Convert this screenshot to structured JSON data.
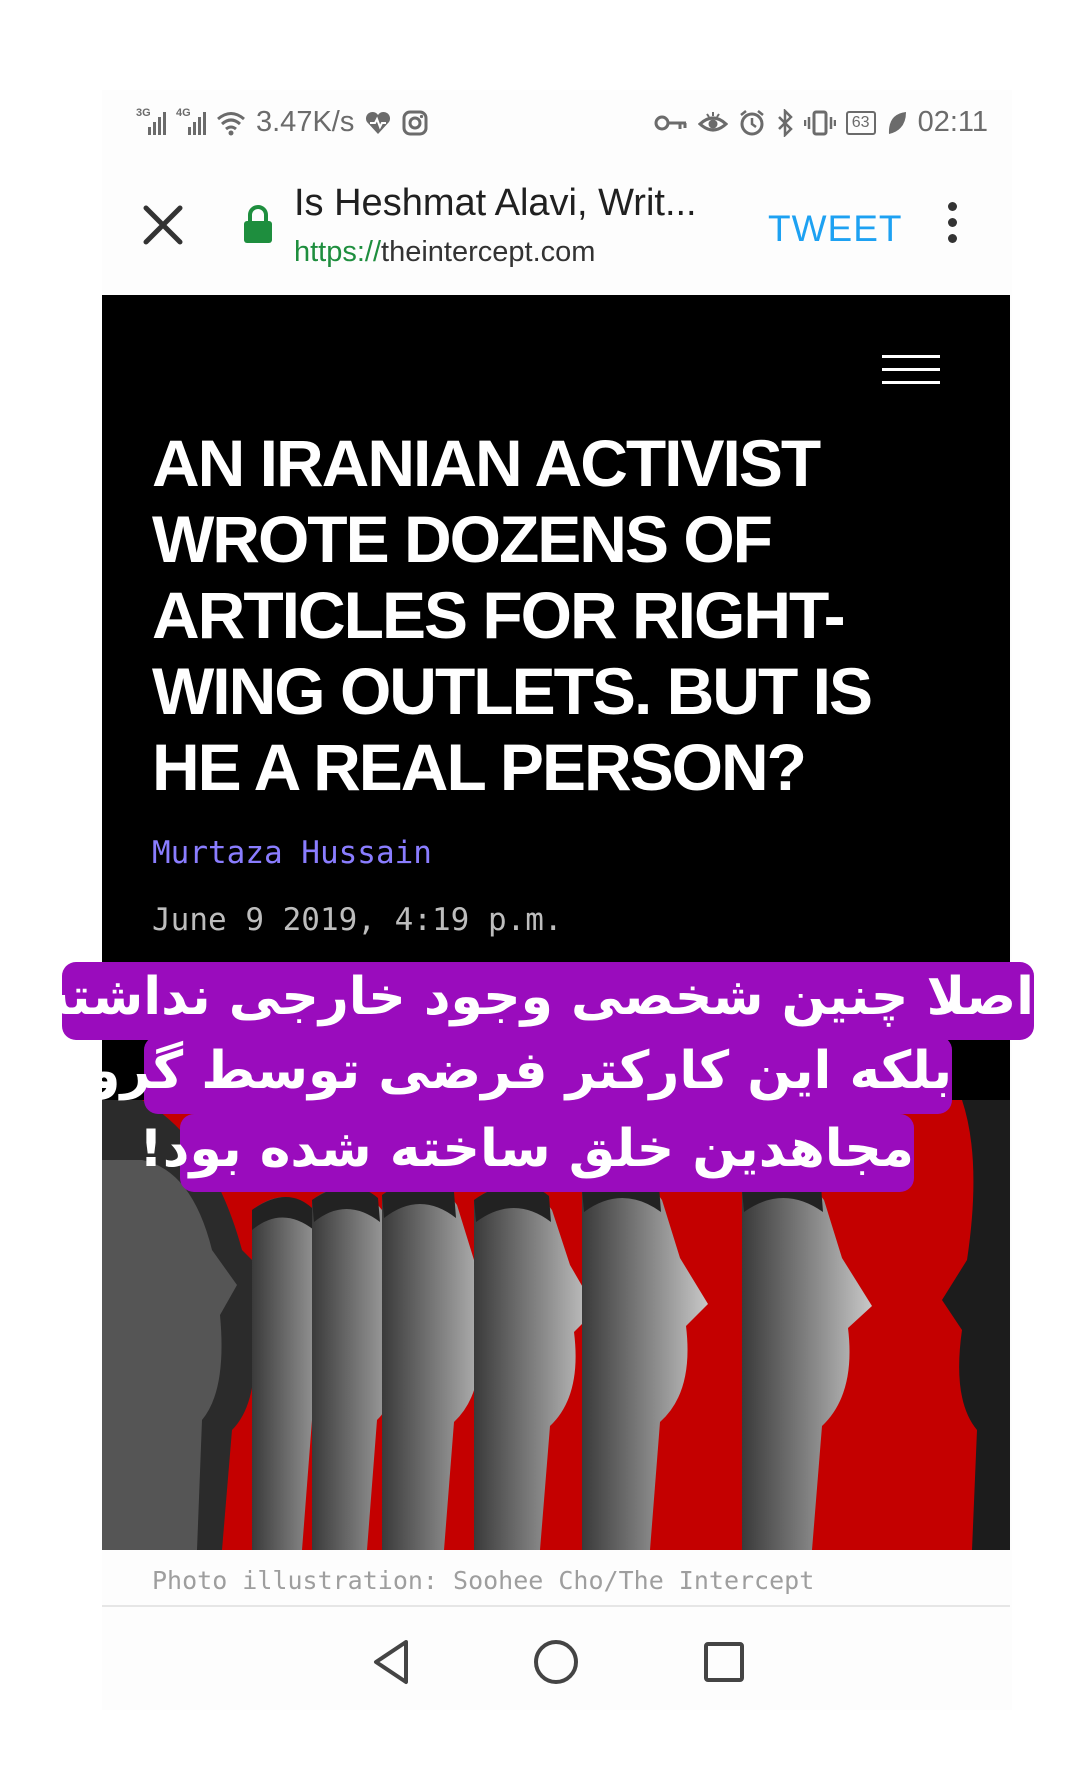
{
  "status_bar": {
    "net_3g": "3G",
    "net_4g": "4G",
    "speed": "3.47K/s",
    "battery": "63",
    "time": "02:11"
  },
  "browser": {
    "title": "Is Heshmat Alavi, Writ...",
    "url_scheme": "https://",
    "url_host": "theintercept.com",
    "tweet_label": "TWEET"
  },
  "article": {
    "headline": "An Iranian activist wrote dozens of articles for right-wing outlets. But is he a real person?",
    "author": "Murtaza Hussain",
    "date": "June 9 2019, 4:19 p.m.",
    "caption": "Photo illustration: Soohee Cho/The Intercept"
  },
  "overlay": {
    "line1": "اصلا چنین شخصی وجود خارجی نداشته.",
    "line2": "بلکه این کارکتر فرضی توسط گروه",
    "line3": "مجاهدین خلق ساخته شده بود!"
  },
  "colors": {
    "overlay_bg": "#9a0cbd",
    "hero_red": "#c40000",
    "author_link": "#8a7dff",
    "tweet_blue": "#1da1f2",
    "secure_green": "#1e8e3e"
  },
  "icons": [
    "signal-icon",
    "wifi-icon",
    "heart-icon",
    "instagram-icon",
    "key-icon",
    "eye-icon",
    "alarm-icon",
    "bluetooth-icon",
    "vibrate-icon",
    "battery-icon",
    "leaf-icon",
    "close-icon",
    "lock-icon",
    "kebab-menu-icon",
    "hamburger-icon",
    "back-icon",
    "home-icon",
    "recents-icon"
  ]
}
